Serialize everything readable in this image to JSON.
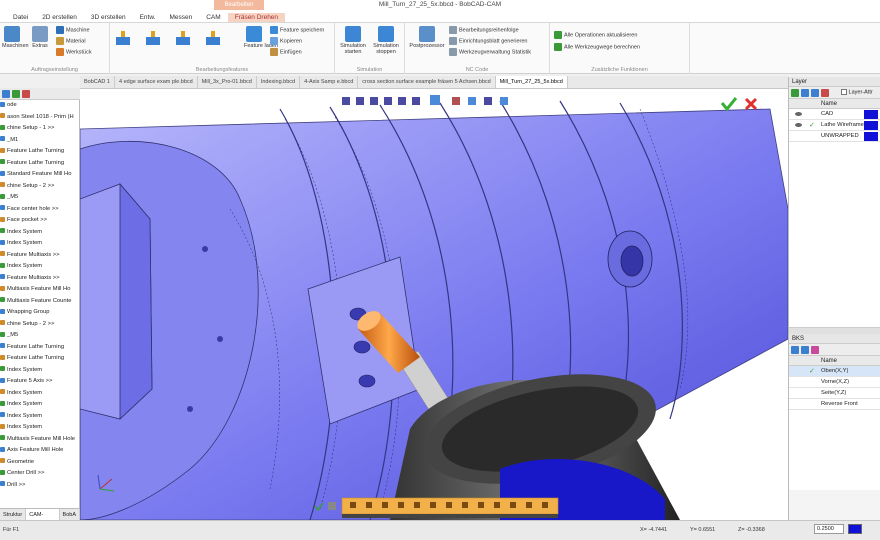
{
  "window": {
    "title": "Mill_Turn_27_25_5x.bbcd - BobCAD-CAM"
  },
  "context_tab": {
    "label": "Bearbeiten"
  },
  "menu": {
    "tabs": [
      "Datei",
      "2D erstellen",
      "3D erstellen",
      "Entw.",
      "Messen",
      "CAM",
      "Fräsen Drehen"
    ],
    "active": 6
  },
  "ribbon": {
    "g1": {
      "big1": "Maschinen",
      "big2": "Extras",
      "b1": "Maschine",
      "b2": "Material",
      "b3": "Werkstück",
      "label": "Auftragseinstellung"
    },
    "g2": {
      "label": "Bearbeitungsfeatures",
      "big": "Feature laden",
      "b1": "Feature speichern",
      "b2": "Kopieren",
      "b3": "Einfügen"
    },
    "g3": {
      "big1": "Simulation starten",
      "big2": "Simulation stoppen",
      "label": "Simulation"
    },
    "g4": {
      "big": "Postprozessor",
      "b1": "Bearbeitungsreihenfolge",
      "b2": "Einrichtungsblatt generieren",
      "b3": "Werkzeugverwaltung Statistik",
      "label": "NC Code"
    },
    "g5": {
      "b1": "Alle Operationen aktualisieren",
      "b2": "Alle Werkzeugwege berechnen",
      "label": "Zusätzliche Funktionen"
    }
  },
  "doc_tabs": [
    "BobCAD 1",
    "4 edge surface exam ple.bbcd",
    "Mill_3x_Pro-01.bbcd",
    "Indexing.bbcd",
    "4-Axis Samp e.bbcd",
    "cross section surface example fräsen 5 Achsen.bbcd",
    "Mill_Turn_27_25_5x.bbcd"
  ],
  "doc_tab_active": 6,
  "tree": [
    "ode",
    "ason Steel 1018 - Prim (H",
    "chine Setup - 1   >>",
    "_M1",
    "Feature Lathe Turning",
    "Feature Lathe Turning",
    "Standard Feature Mill Ho",
    "chine Setup - 2   >>",
    "_M5",
    "Face center hole  >>",
    "Face pocket   >>",
    "Index System",
    "Index System",
    "Feature Multiaxis  >>",
    "Index System",
    "Feature Multiaxis  >>",
    "Multiaxis Feature Mill Ho",
    "Multiaxis Feature Counte",
    "Wrapping Group",
    "chine Setup - 2   >>",
    "_M5",
    "Feature Lathe Turning",
    "Feature Lathe Turning",
    "Index System",
    "Feature 5 Axis  >>",
    "Index System",
    "Index System",
    "Index System",
    "Index System",
    "Multiaxis Feature Mill Hole",
    "Axis Feature Mill Hole",
    "Geometrie",
    "Center Drill  >>",
    "Drill   >>"
  ],
  "left_tabs": [
    "Struktur",
    "CAM-Strukt",
    "BobA"
  ],
  "layers": {
    "title": "Layer",
    "filter_label": "Layer-Attr",
    "header": "Name",
    "rows": [
      {
        "name": "CAD",
        "visible": true,
        "active": false
      },
      {
        "name": "Lathe Wireframe",
        "visible": true,
        "active": true
      },
      {
        "name": "UNWRAPPED",
        "visible": false,
        "active": false
      }
    ]
  },
  "wcs": {
    "title": "BKS",
    "header": "Name",
    "rows": [
      {
        "name": "Oben(X,Y)",
        "active": true
      },
      {
        "name": "Vorne(X,Z)",
        "active": false
      },
      {
        "name": "Seite(Y,Z)",
        "active": false
      },
      {
        "name": "Reverse Front",
        "active": false
      }
    ]
  },
  "status": {
    "left": "Für F1",
    "x": "X= -4.7441",
    "y": "Y= 0.6551",
    "z": "Z= -0.3368",
    "zoom": "0.2500"
  },
  "colors": {
    "body": "#7b7bf2",
    "accent": "#1010d8",
    "tool": "#f08a2a",
    "sim_bar": "#f2b04a"
  }
}
